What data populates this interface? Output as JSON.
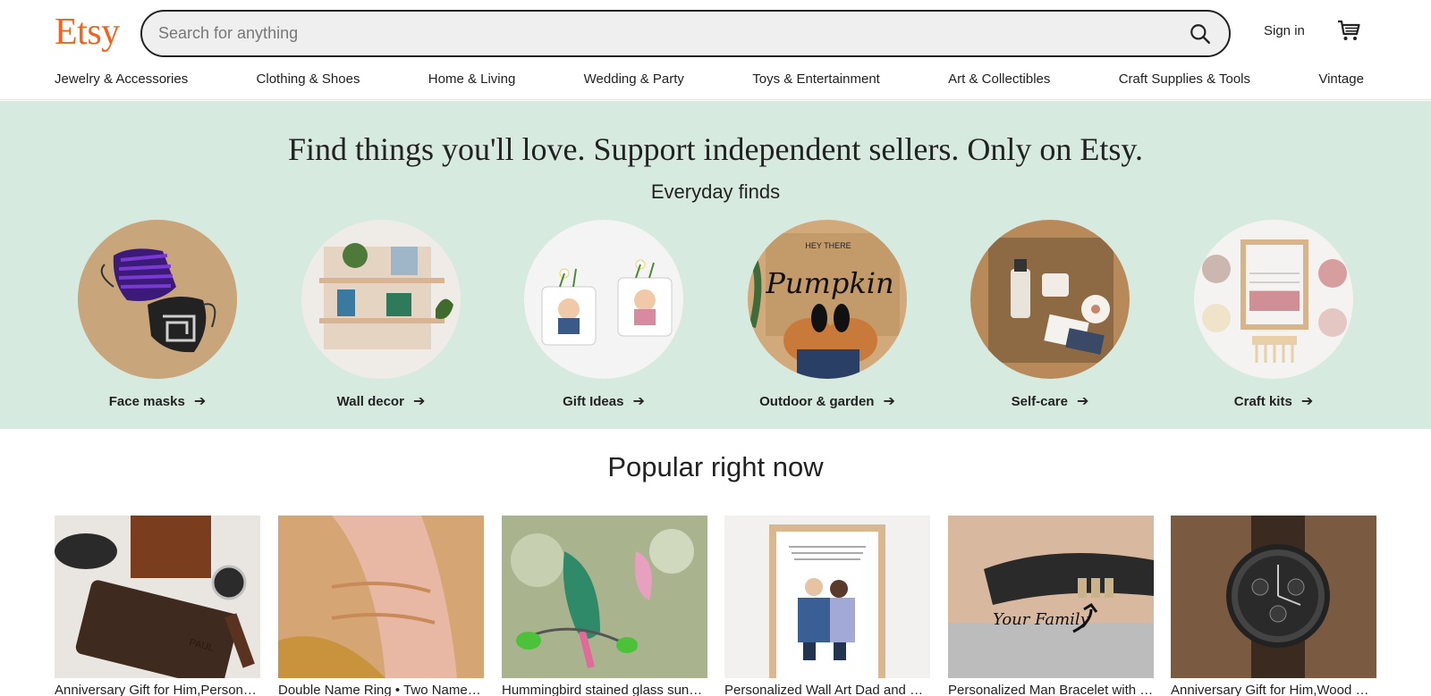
{
  "header": {
    "logo": "Etsy",
    "search_placeholder": "Search for anything",
    "signin_label": "Sign in"
  },
  "nav": [
    "Jewelry & Accessories",
    "Clothing & Shoes",
    "Home & Living",
    "Wedding & Party",
    "Toys & Entertainment",
    "Art & Collectibles",
    "Craft Supplies & Tools",
    "Vintage"
  ],
  "hero": {
    "title": "Find things you'll love. Support independent sellers. Only on Etsy.",
    "subtitle": "Everyday finds",
    "categories": [
      {
        "label": "Face masks"
      },
      {
        "label": "Wall decor"
      },
      {
        "label": "Gift Ideas"
      },
      {
        "label": "Outdoor & garden"
      },
      {
        "label": "Self-care"
      },
      {
        "label": "Craft kits"
      }
    ]
  },
  "popular": {
    "title": "Popular right now",
    "items": [
      {
        "title": "Anniversary Gift for Him,Personalized Wallet"
      },
      {
        "title": "Double Name Ring • Two Name Ring"
      },
      {
        "title": "Hummingbird stained glass suncatcher"
      },
      {
        "title": "Personalized Wall Art Dad and Daughter"
      },
      {
        "title": "Personalized Man Bracelet with Beads"
      },
      {
        "title": "Anniversary Gift for Him,Wood Watch"
      }
    ],
    "overlay_texts": {
      "doormat": "Pumpkin",
      "doormat_top": "HEY THERE",
      "bracelet": "Your Family",
      "wallet": "PAUL"
    }
  },
  "colors": {
    "brand": "#f1641e",
    "hero_bg": "#d7eadf"
  }
}
